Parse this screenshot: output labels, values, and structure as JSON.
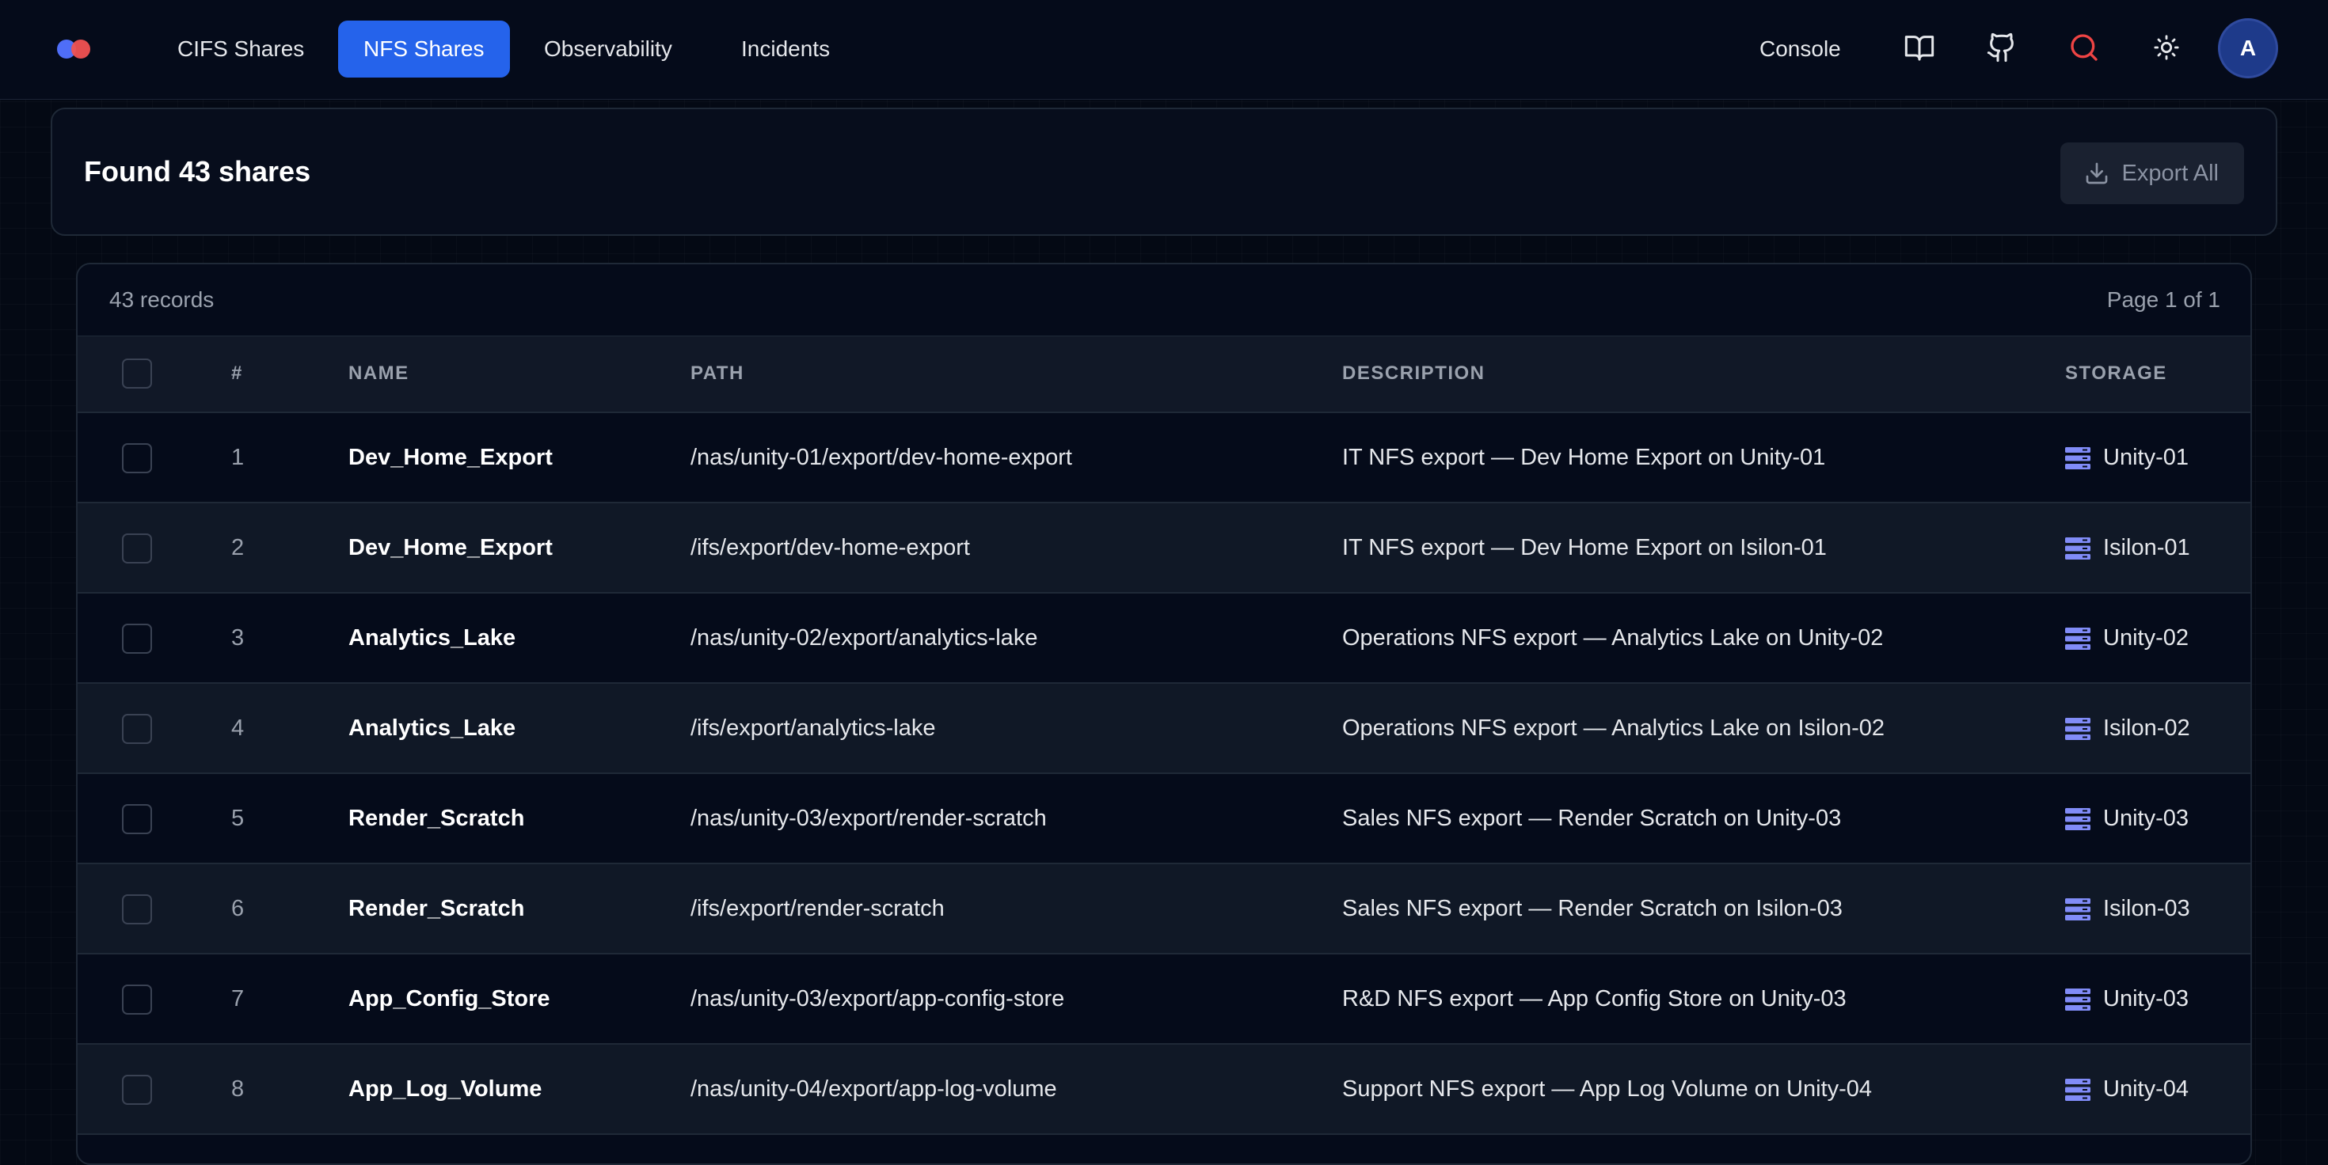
{
  "nav": {
    "tabs": [
      {
        "label": "CIFS Shares",
        "active": false
      },
      {
        "label": "NFS Shares",
        "active": true
      },
      {
        "label": "Observability",
        "active": false
      },
      {
        "label": "Incidents",
        "active": false
      }
    ],
    "console_label": "Console",
    "icons": [
      "book-icon",
      "github-icon",
      "search-icon",
      "sun-icon"
    ],
    "avatar_initial": "A"
  },
  "summary": {
    "title": "Found 43 shares",
    "export_label": "Export All"
  },
  "table": {
    "records_label": "43 records",
    "page_label": "Page 1 of 1",
    "columns": [
      "#",
      "NAME",
      "PATH",
      "DESCRIPTION",
      "STORAGE"
    ],
    "rows": [
      {
        "index": "1",
        "name": "Dev_Home_Export",
        "path": "/nas/unity-01/export/dev-home-export",
        "description": "IT NFS export — Dev Home Export on Unity-01",
        "storage": "Unity-01"
      },
      {
        "index": "2",
        "name": "Dev_Home_Export",
        "path": "/ifs/export/dev-home-export",
        "description": "IT NFS export — Dev Home Export on Isilon-01",
        "storage": "Isilon-01"
      },
      {
        "index": "3",
        "name": "Analytics_Lake",
        "path": "/nas/unity-02/export/analytics-lake",
        "description": "Operations NFS export — Analytics Lake on Unity-02",
        "storage": "Unity-02"
      },
      {
        "index": "4",
        "name": "Analytics_Lake",
        "path": "/ifs/export/analytics-lake",
        "description": "Operations NFS export — Analytics Lake on Isilon-02",
        "storage": "Isilon-02"
      },
      {
        "index": "5",
        "name": "Render_Scratch",
        "path": "/nas/unity-03/export/render-scratch",
        "description": "Sales NFS export — Render Scratch on Unity-03",
        "storage": "Unity-03"
      },
      {
        "index": "6",
        "name": "Render_Scratch",
        "path": "/ifs/export/render-scratch",
        "description": "Sales NFS export — Render Scratch on Isilon-03",
        "storage": "Isilon-03"
      },
      {
        "index": "7",
        "name": "App_Config_Store",
        "path": "/nas/unity-03/export/app-config-store",
        "description": "R&D NFS export — App Config Store on Unity-03",
        "storage": "Unity-03"
      },
      {
        "index": "8",
        "name": "App_Log_Volume",
        "path": "/nas/unity-04/export/app-log-volume",
        "description": "Support NFS export — App Log Volume on Unity-04",
        "storage": "Unity-04"
      }
    ]
  },
  "colors": {
    "accent": "#2563eb",
    "background": "#040914",
    "storage_icon": "#818cf8",
    "search_icon": "#ef4444"
  }
}
